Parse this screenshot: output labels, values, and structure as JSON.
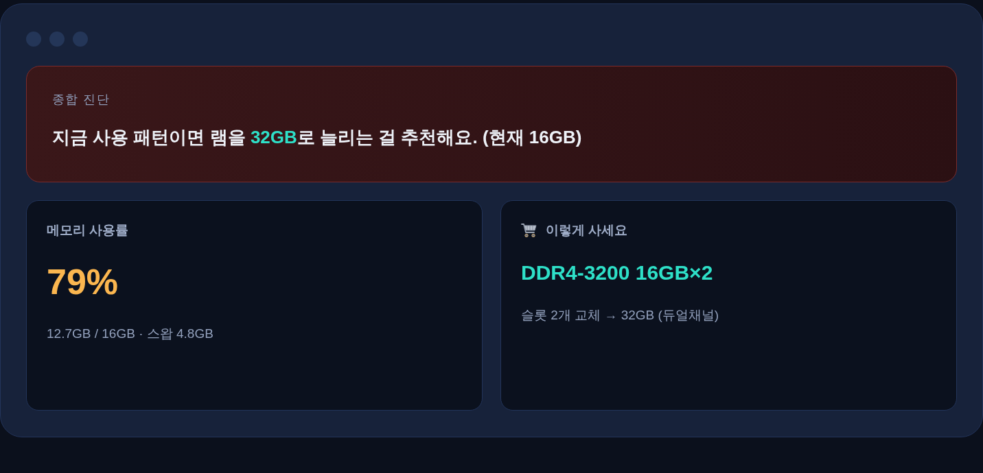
{
  "diagnosis": {
    "label": "종합 진단",
    "headline": "지금 사용 패턴이면 램을 **32GB**로 늘리는 걸 추천해요. (현재 16GB)"
  },
  "cards": [
    {
      "kind": "usage",
      "title": "메모리 사용률",
      "value": "79%",
      "detail": "12.7GB / 16GB · 스왑 4.8GB"
    },
    {
      "kind": "purchase",
      "title": "이렇게 사세요",
      "value": "DDR4-3200 16GB×2",
      "detail": "슬롯 2개 교체 → 32GB (듀얼채널)"
    }
  ]
}
